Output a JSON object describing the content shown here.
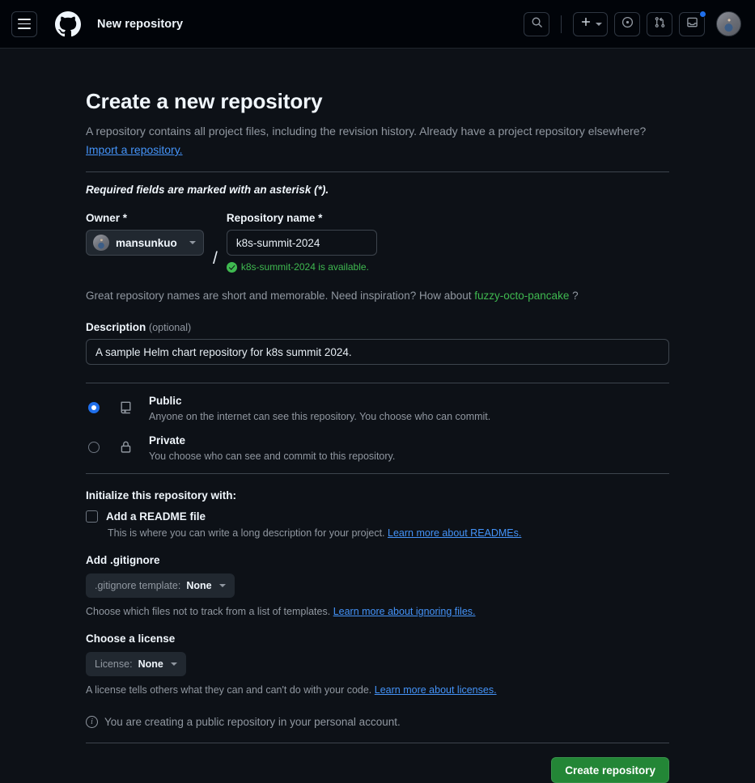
{
  "header": {
    "title": "New repository",
    "menu_icon": "hamburger-menu-icon",
    "logo_icon": "github-logo-icon",
    "search_icon": "search-icon",
    "create_new_icon": "plus-icon",
    "issues_icon": "issue-opened-icon",
    "pull_requests_icon": "git-pull-request-icon",
    "inbox_icon": "inbox-icon",
    "avatar_icon": "user-avatar"
  },
  "page": {
    "title": "Create a new repository",
    "subtitle": "A repository contains all project files, including the revision history. Already have a project repository elsewhere?",
    "import_link": "Import a repository.",
    "required_note": "Required fields are marked with an asterisk (*)."
  },
  "owner": {
    "label": "Owner *",
    "name": "mansunkuo",
    "separator": "/"
  },
  "repository": {
    "label": "Repository name *",
    "value": "k8s-summit-2024",
    "placeholder": "",
    "availability": "k8s-summit-2024 is available.",
    "availability_icon": "check-circle-fill-icon",
    "hint_prefix": "Great repository names are short and memorable. Need inspiration? How about",
    "hint_suggestion": "fuzzy-octo-pancake",
    "hint_suffix": "?"
  },
  "description": {
    "label": "Description",
    "optional": "(optional)",
    "value": "A sample Helm chart repository for k8s summit 2024.",
    "placeholder": ""
  },
  "visibility": {
    "options": [
      {
        "name": "Public",
        "description": "Anyone on the internet can see this repository. You choose who can commit.",
        "icon": "repo-icon",
        "selected": true
      },
      {
        "name": "Private",
        "description": "You choose who can see and commit to this repository.",
        "icon": "lock-icon",
        "selected": false
      }
    ]
  },
  "initialize": {
    "heading": "Initialize this repository with:",
    "readme_label": "Add a README file",
    "readme_checked": false,
    "readme_desc_prefix": "This is where you can write a long description for your project.",
    "readme_desc_link": "Learn more about READMEs."
  },
  "gitignore": {
    "heading": "Add .gitignore",
    "button_prefix": ".gitignore template:",
    "button_value": "None",
    "note_prefix": "Choose which files not to track from a list of templates.",
    "note_link": "Learn more about ignoring files."
  },
  "license": {
    "heading": "Choose a license",
    "button_prefix": "License:",
    "button_value": "None",
    "note_prefix": "A license tells others what they can and can't do with your code.",
    "note_link": "Learn more about licenses."
  },
  "footer": {
    "info_icon": "info-icon",
    "info_text": "You are creating a public repository in your personal account.",
    "create_button": "Create repository"
  },
  "colors": {
    "page_bg": "#0d1117",
    "header_bg": "#010409",
    "accent_green": "#238636",
    "accent_blue": "#1f6feb",
    "link_blue": "#4493f8",
    "success_green": "#3fb950",
    "border": "#3d444d",
    "muted_text": "#9198a1"
  }
}
